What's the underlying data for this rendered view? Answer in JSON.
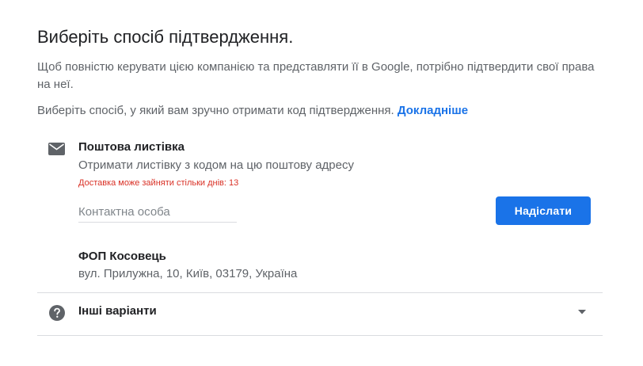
{
  "page": {
    "title": "Виберіть спосіб підтвердження.",
    "intro": "Щоб повністю керувати цією компанією та представляти її в Google, потрібно підтвердити свої права на неї.",
    "choose_text": "Виберіть спосіб, у який вам зручно отримати код підтвердження.",
    "learn_more": "Докладніше"
  },
  "postcard": {
    "icon": "mail-icon",
    "title": "Поштова листівка",
    "description": "Отримати листівку з кодом на цю поштову адресу",
    "warning": "Доставка може зайняти стільки днів: 13",
    "contact_placeholder": "Контактна особа",
    "contact_value": "",
    "send_label": "Надіслати",
    "business_name": "ФОП Косовець",
    "address": "вул. Прилужна, 10, Київ, 03179, Україна"
  },
  "other": {
    "icon": "help-icon",
    "label": "Інші варіанти",
    "expand_icon": "caret-down-icon"
  },
  "colors": {
    "accent": "#1a73e8",
    "warning": "#d93025",
    "text_primary": "#202124",
    "text_secondary": "#5f6368",
    "icon_gray": "#5f6368",
    "divider": "#dadce0"
  }
}
